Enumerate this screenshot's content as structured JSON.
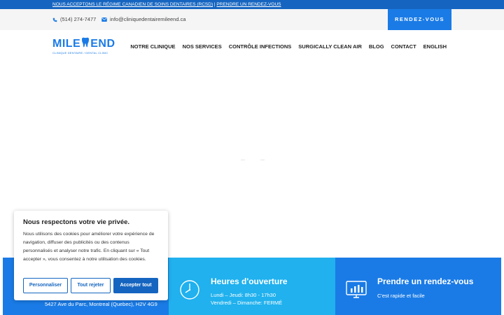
{
  "announcement": {
    "link1": "NOUS ACCEPTONS LE RÉGIME CANADIEN DE SOINS DENTAIRES (RCSD)",
    "separator": " | ",
    "link2": "PRENDRE UN RENDEZ-VOUS"
  },
  "contact": {
    "phone": "(514) 274-7477",
    "email": "info@cliniquedentairemileend.ca",
    "cta": "RENDEZ-VOUS"
  },
  "logo": {
    "left": "MILE",
    "right": "END",
    "tagline": "CLINIQUE DENTAIRE / DENTAL CLINIC"
  },
  "nav": {
    "items": [
      "NOTRE CLINIQUE",
      "NOS SERVICES",
      "CONTRÔLE INFECTIONS",
      "SURGICALLY CLEAN AIR",
      "BLOG",
      "CONTACT",
      "ENGLISH"
    ]
  },
  "info": {
    "address": "5427 Ave du Parc, Montreal (Quebec), H2V 4G9",
    "hours": {
      "title": "Heures d'ouverture",
      "line1": "Lundi – Jeudi: 8h30 - 17h30",
      "line2": "Vendredi – Dimanche: FERMÉ"
    },
    "booking": {
      "title": "Prendre un rendez-vous",
      "subtitle": "C'est rapide et facile"
    }
  },
  "cookie": {
    "title": "Nous respectons votre vie privée.",
    "body": "Nous utilisons des cookies pour améliorer votre expérience de navigation, diffuser des publicités ou des contenus personnalisés et analyser notre trafic. En cliquant sur « Tout accepter », vous consentez à notre utilisation des cookies.",
    "customize": "Personnaliser",
    "reject": "Tout rejeter",
    "accept": "Accepter tout"
  },
  "colors": {
    "primary": "#1a7be6",
    "announce": "#1565c0",
    "light_band": "#20b1ee"
  }
}
